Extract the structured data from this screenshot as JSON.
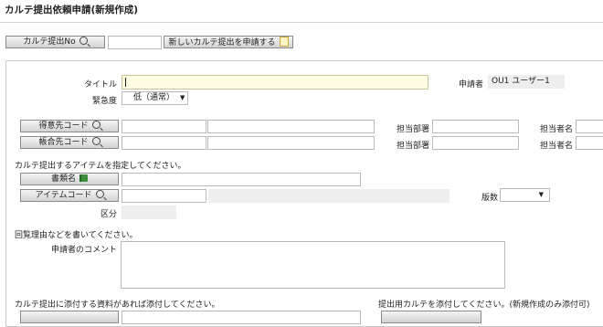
{
  "window": {
    "title": "カルテ提出依頼申請(新規作成)"
  },
  "topbar": {
    "karte_no_button": "カルテ提出No",
    "karte_no_value": "",
    "new_request_button": "新しいカルテ提出を申請する"
  },
  "form": {
    "title_label": "タイトル",
    "title_value": "",
    "applicant_label": "申請者",
    "applicant_value": "OU1 ユーザー1",
    "urgency_label": "緊急度",
    "urgency_value": "低（通常）",
    "customer_code_button": "得意先コード",
    "customer_dept_label": "担当部署",
    "customer_person_label": "担当者名",
    "account_code_button": "帳合先コード",
    "account_dept_label": "担当部署",
    "account_person_label": "担当者名",
    "item_instruction": "カルテ提出するアイテムを指定してください。",
    "document_name_button": "書類名",
    "item_code_button": "アイテムコード",
    "edition_label": "版数",
    "edition_value": "",
    "category_label": "区分",
    "category_value": "",
    "reason_instruction": "回覧理由などを書いてください。",
    "comment_label": "申請者のコメント",
    "comment_value": "",
    "attach_instruction": "カルテ提出に添付する資料があれば添付してください。",
    "karte_attach_instruction": "提出用カルテを添付してください。(新規作成のみ添付可)"
  },
  "icons": {
    "search": "magnifier-icon",
    "book": "book-icon",
    "document": "document-icon",
    "dropdown": "dropdown-arrow"
  },
  "colors": {
    "title_field_bg": "#fdfbe0",
    "readonly_bg": "#eeeeee",
    "button_top": "#f4f4f4",
    "button_bottom": "#d3d3d3"
  }
}
